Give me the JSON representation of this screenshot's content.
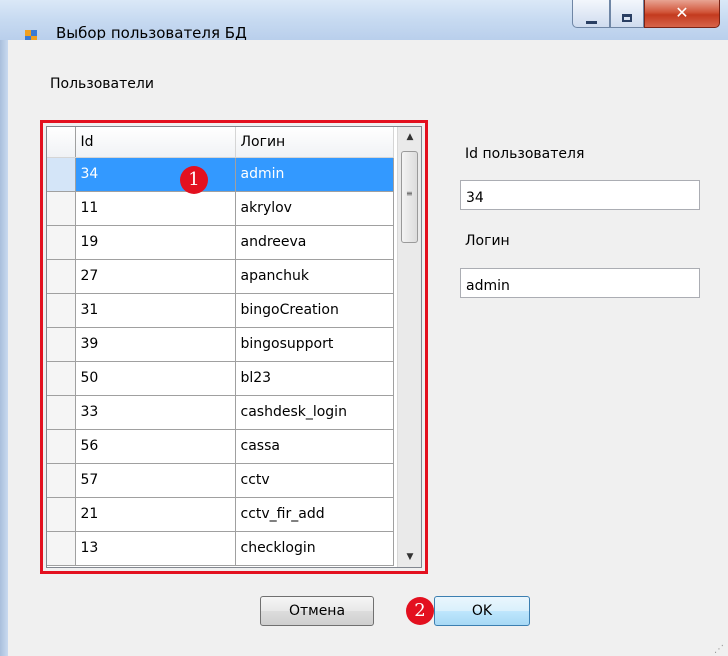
{
  "window": {
    "title": "Выбор пользователя БД",
    "caption_buttons": {
      "minimize": "–",
      "maximize": "□",
      "close": "✕"
    }
  },
  "users_group_label": "Пользователи",
  "grid": {
    "columns": [
      "Id",
      "Логин"
    ],
    "rows": [
      {
        "id": "34",
        "login": "admin",
        "selected": true
      },
      {
        "id": "11",
        "login": "akrylov"
      },
      {
        "id": "19",
        "login": "andreeva"
      },
      {
        "id": "27",
        "login": "apanchuk"
      },
      {
        "id": "31",
        "login": "bingoCreation"
      },
      {
        "id": "39",
        "login": "bingosupport"
      },
      {
        "id": "50",
        "login": "bl23"
      },
      {
        "id": "33",
        "login": "cashdesk_login"
      },
      {
        "id": "56",
        "login": "cassa"
      },
      {
        "id": "57",
        "login": "cctv"
      },
      {
        "id": "21",
        "login": "cctv_fir_add"
      },
      {
        "id": "13",
        "login": "checklogin"
      }
    ],
    "scroll_up_icon": "▲",
    "scroll_down_icon": "▼",
    "grip_icon": "≡"
  },
  "details": {
    "id_label": "Id пользователя",
    "id_value": "34",
    "login_label": "Логин",
    "login_value": "admin"
  },
  "buttons": {
    "cancel": "Отмена",
    "ok": "OK"
  },
  "annotations": {
    "badge1": "1",
    "badge2": "2",
    "color": "#e3101f"
  },
  "colors": {
    "selection": "#3399ff",
    "title_bar": "#c7daf1",
    "close_button": "#c33a1f"
  }
}
